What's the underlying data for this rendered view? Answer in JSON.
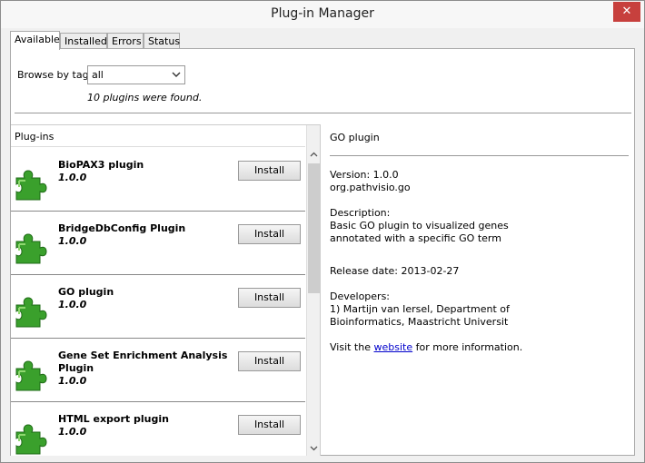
{
  "window": {
    "title": "Plug-in Manager",
    "close_glyph": "✕"
  },
  "tabs": [
    {
      "label": "Available",
      "active": true
    },
    {
      "label": "Installed",
      "active": false
    },
    {
      "label": "Errors",
      "active": false
    },
    {
      "label": "Status",
      "active": false
    }
  ],
  "browse": {
    "label": "Browse by tag",
    "selected": "all",
    "found_text": "10 plugins were found."
  },
  "list": {
    "header": "Plug-ins",
    "install_label": "Install",
    "items": [
      {
        "name": "BioPAX3 plugin",
        "version": "1.0.0"
      },
      {
        "name": "BridgeDbConfig Plugin",
        "version": "1.0.0"
      },
      {
        "name": "GO plugin",
        "version": "1.0.0"
      },
      {
        "name": "Gene Set Enrichment Analysis Plugin",
        "version": "1.0.0"
      },
      {
        "name": "HTML export plugin",
        "version": "1.0.0"
      }
    ]
  },
  "detail": {
    "title": "GO plugin",
    "version_line": "Version: 1.0.0",
    "package": "org.pathvisio.go",
    "description_label": "Description:",
    "description_line1": "Basic GO plugin to visualized genes",
    "description_line2": "annotated with a specific GO term",
    "release_date": "Release date: 2013-02-27",
    "developers_label": "Developers:",
    "developers_line1": "1) Martijn van Iersel, Department of",
    "developers_line2": "Bioinformatics, Maastricht Universit",
    "visit_prefix": "Visit the ",
    "visit_link": "website",
    "visit_suffix": " for more information."
  },
  "colors": {
    "puzzle_green": "#3aa02c",
    "close_red": "#c7403d",
    "link": "#0000cc"
  },
  "icons": {
    "plugin": "puzzle-piece-icon",
    "dropdown": "chevron-down-icon"
  }
}
